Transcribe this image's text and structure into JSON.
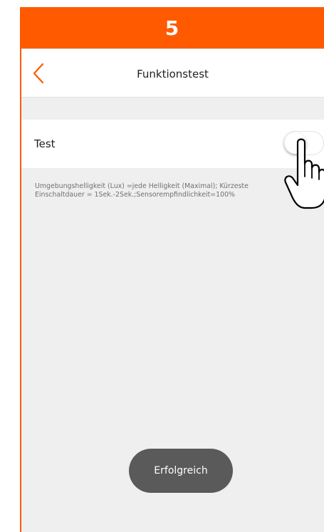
{
  "step": {
    "number": "5"
  },
  "colors": {
    "accent": "#ff5a00",
    "background": "#efefef",
    "toast": "#5a5a5a"
  },
  "header": {
    "back_icon": "chevron-left-icon",
    "title": "Funktionstest"
  },
  "settings": {
    "test_label": "Test",
    "toggle_state": "off"
  },
  "description": {
    "line1": "Umgebungshelligkeit (Lux) =jede Helligkeit (Maximal); Kürzeste",
    "line2": "Einschaltdauer = 1Sek.-2Sek.;Sensorempfindlichkeit=100%"
  },
  "toast": {
    "label": "Erfolgreich"
  },
  "overlay": {
    "icon": "pointing-hand-icon"
  }
}
